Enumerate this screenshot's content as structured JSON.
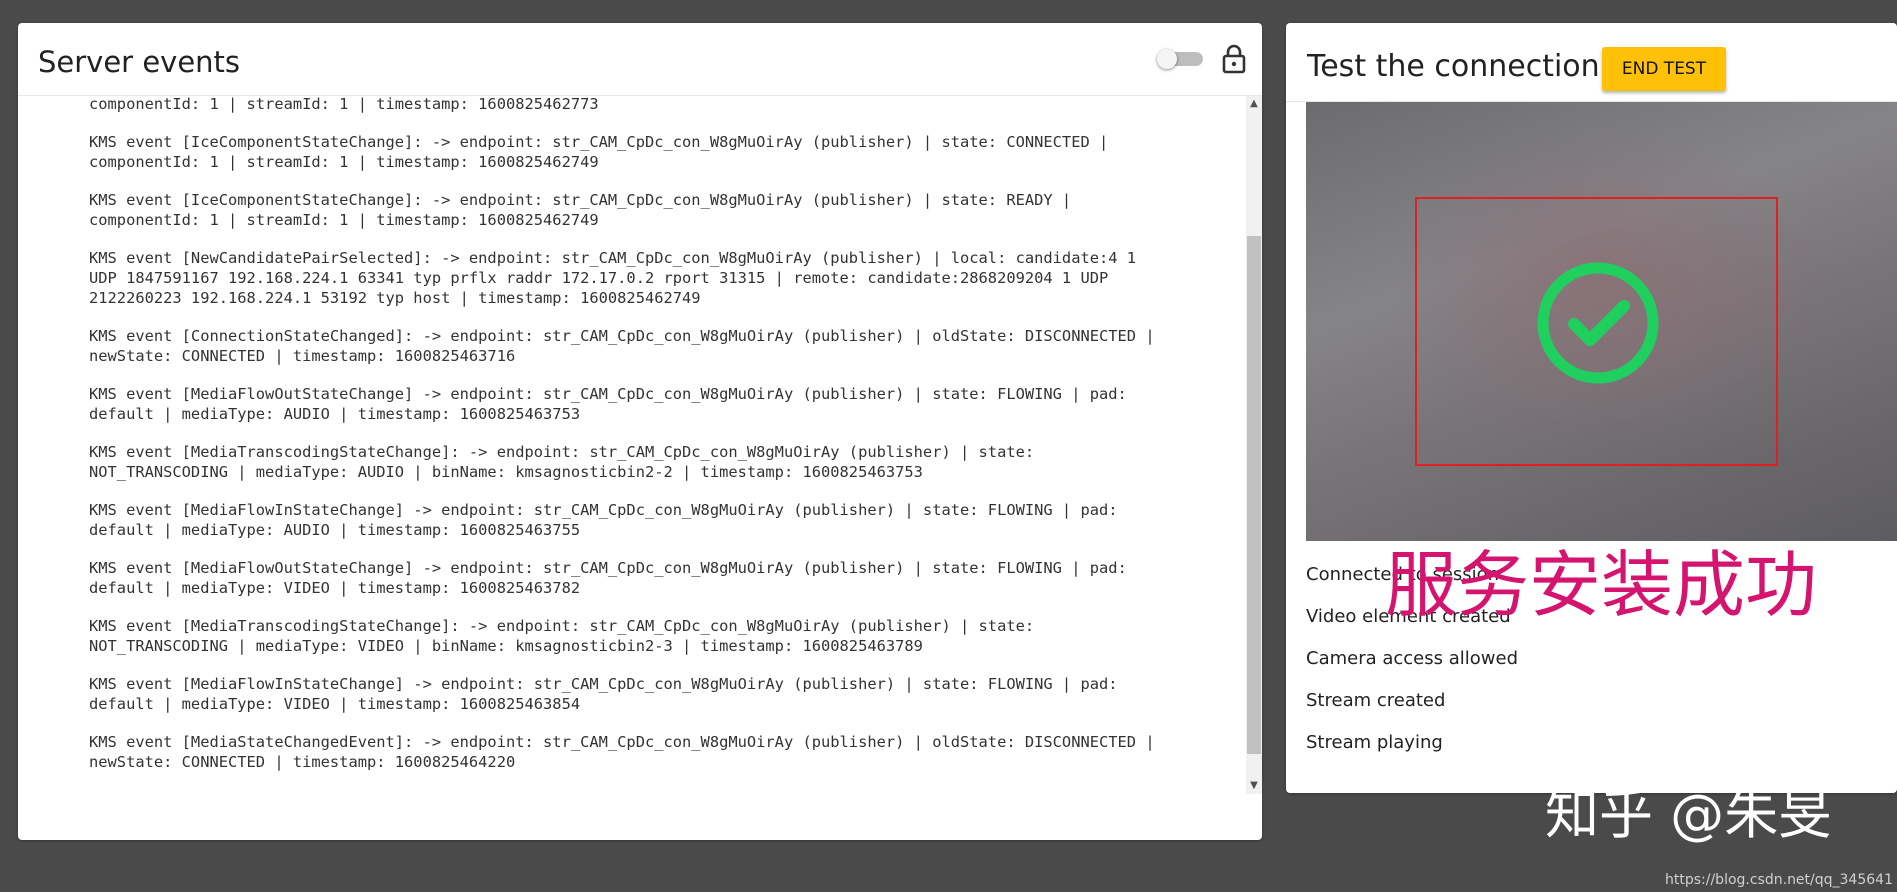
{
  "server_events": {
    "title": "Server events",
    "log_entries": [
      "componentId: 1 | streamId: 1 | timestamp: 1600825462773",
      "KMS event [IceComponentStateChange]: -> endpoint: str_CAM_CpDc_con_W8gMuOirAy (publisher) | state: CONNECTED |\ncomponentId: 1 | streamId: 1 | timestamp: 1600825462749",
      "KMS event [IceComponentStateChange]: -> endpoint: str_CAM_CpDc_con_W8gMuOirAy (publisher) | state: READY |\ncomponentId: 1 | streamId: 1 | timestamp: 1600825462749",
      "KMS event [NewCandidatePairSelected]: -> endpoint: str_CAM_CpDc_con_W8gMuOirAy (publisher) | local: candidate:4 1\nUDP 1847591167 192.168.224.1 63341 typ prflx raddr 172.17.0.2 rport 31315 | remote: candidate:2868209204 1 UDP\n2122260223 192.168.224.1 53192 typ host | timestamp: 1600825462749",
      "KMS event [ConnectionStateChanged]: -> endpoint: str_CAM_CpDc_con_W8gMuOirAy (publisher) | oldState: DISCONNECTED |\nnewState: CONNECTED | timestamp: 1600825463716",
      "KMS event [MediaFlowOutStateChange] -> endpoint: str_CAM_CpDc_con_W8gMuOirAy (publisher) | state: FLOWING | pad:\ndefault | mediaType: AUDIO | timestamp: 1600825463753",
      "KMS event [MediaTranscodingStateChange]: -> endpoint: str_CAM_CpDc_con_W8gMuOirAy (publisher) | state:\nNOT_TRANSCODING | mediaType: AUDIO | binName: kmsagnosticbin2-2 | timestamp: 1600825463753",
      "KMS event [MediaFlowInStateChange] -> endpoint: str_CAM_CpDc_con_W8gMuOirAy (publisher) | state: FLOWING | pad:\ndefault | mediaType: AUDIO | timestamp: 1600825463755",
      "KMS event [MediaFlowOutStateChange] -> endpoint: str_CAM_CpDc_con_W8gMuOirAy (publisher) | state: FLOWING | pad:\ndefault | mediaType: VIDEO | timestamp: 1600825463782",
      "KMS event [MediaTranscodingStateChange]: -> endpoint: str_CAM_CpDc_con_W8gMuOirAy (publisher) | state:\nNOT_TRANSCODING | mediaType: VIDEO | binName: kmsagnosticbin2-3 | timestamp: 1600825463789",
      "KMS event [MediaFlowInStateChange] -> endpoint: str_CAM_CpDc_con_W8gMuOirAy (publisher) | state: FLOWING | pad:\ndefault | mediaType: VIDEO | timestamp: 1600825463854",
      "KMS event [MediaStateChangedEvent]: -> endpoint: str_CAM_CpDc_con_W8gMuOirAy (publisher) | oldState: DISCONNECTED |\nnewState: CONNECTED | timestamp: 1600825464220"
    ],
    "toggle_on": false,
    "icons": [
      "toggle-switch",
      "lock-icon"
    ]
  },
  "test_connection": {
    "title": "Test the connection",
    "end_test_label": "END TEST",
    "status_items": [
      "Connected to session",
      "Video element created",
      "Camera access allowed",
      "Stream created",
      "Stream playing"
    ],
    "icons": [
      "check-circle-icon"
    ]
  },
  "overlay_text": "服务安装成功",
  "watermark": "知乎 @朱旻",
  "csdn_watermark": "https://blog.csdn.net/qq_345641",
  "colors": {
    "background": "#4a4a4a",
    "button": "#ffc107",
    "check": "#1fd05f",
    "face_box": "#e02020",
    "overlay_text": "#d4146e"
  }
}
